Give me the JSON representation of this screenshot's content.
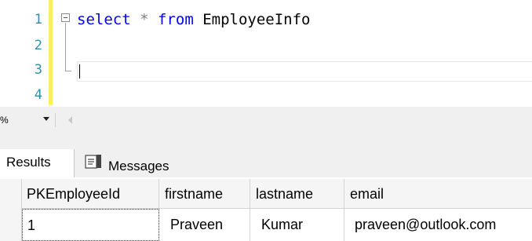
{
  "editor": {
    "line_numbers": [
      "1",
      "2",
      "3",
      "4"
    ],
    "code": {
      "kw_select": "select",
      "star": "*",
      "kw_from": "from",
      "table": "EmployeeInfo"
    },
    "colors": {
      "keyword": "#0000ff",
      "line_number": "#2b91af",
      "change_bar": "#ffee62"
    }
  },
  "zoom": {
    "value": "%"
  },
  "results": {
    "tabs": [
      {
        "label": "Results",
        "icon": "grid-icon"
      },
      {
        "label": "Messages",
        "icon": "messages-icon"
      }
    ],
    "columns": [
      "PKEmployeeId",
      "firstname",
      "lastname",
      "email"
    ],
    "rows": [
      [
        "1",
        "Praveen",
        "Kumar",
        "praveen@outlook.com"
      ]
    ]
  }
}
